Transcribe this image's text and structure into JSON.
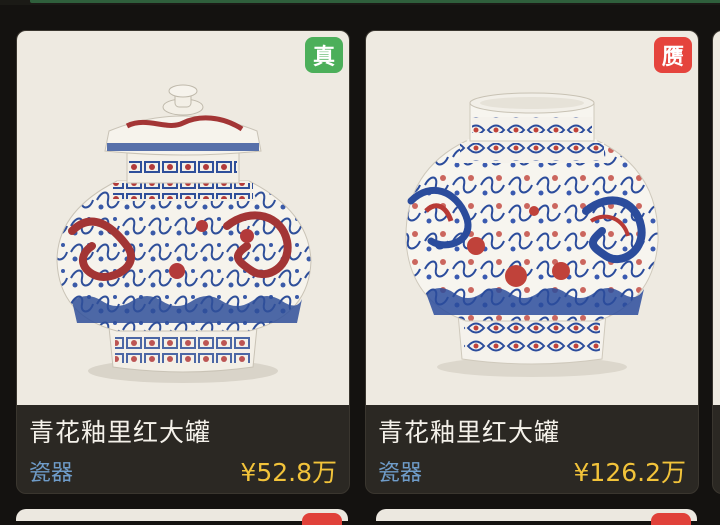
{
  "products": [
    {
      "title": "青花釉里红大罐",
      "category": "瓷器",
      "price": "¥52.8万",
      "badge": "真",
      "badge_color": "#4caf5a",
      "image": "blue-and-white-underglaze-red-lidded-jar-with-dragons"
    },
    {
      "title": "青花釉里红大罐",
      "category": "瓷器",
      "price": "¥126.2万",
      "badge": "赝",
      "badge_color": "#e5443d",
      "image": "blue-and-white-underglaze-red-jar-with-dragon-and-phoenix"
    }
  ],
  "colors": {
    "background": "#141210",
    "card": "#2b2823",
    "title": "#f4f1ea",
    "category": "#6f9cc9",
    "price": "#f2c33a"
  }
}
